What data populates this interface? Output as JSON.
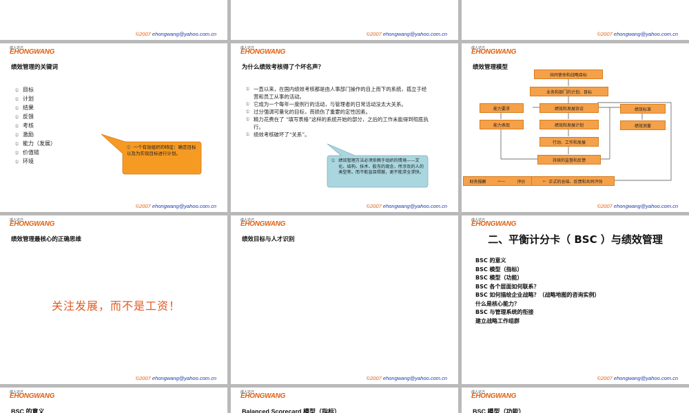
{
  "footer": {
    "year": "©2007",
    "email": "ehongwang@yahoo.com.cn"
  },
  "logo": {
    "caption": "成人达己",
    "brand": "EHONGWANG"
  },
  "slide_kw": {
    "title": "绩效管理的关键词",
    "items": [
      "目标",
      "计划",
      "结果",
      "反馈",
      "考核",
      "激励",
      "能力（发展）",
      "价值链",
      "环境"
    ],
    "callout": "一个有效组织的特征：确定目标以及为实现目标进行计划。"
  },
  "slide_bad": {
    "title": "为什么绩效考核得了个坏名声？",
    "points": [
      "一直以来，在国内绩效考核都是由人事部门操作的自上而下的系统，孤立于经营和员工从事的活动。",
      "它成为一个每年一度例行的活动，与管理者的日常活动没太大关系。",
      "过分强调可量化的目标，而损伤了重要的定性因素。",
      "精力花费在了 “填写表格”这样的系统开始的部分，之后的工作未能得到彻底执行。",
      "绩效考核破坏了“关系”。"
    ],
    "callout": "绩效管理方法必须依赖于组织的情境——文化、结构、技术、股东的观念，所涉及的人的类型等。而不能盲目照搬，更不能求全求快。"
  },
  "slide_model": {
    "title": "绩效管理模型",
    "boxes": {
      "mission": "共同使命和战略目标",
      "dept": "业务和部门的计划、目标",
      "agreement": "绩效和发展协议",
      "plan": "绩效和发展计划",
      "action": "行动、工作和发展",
      "monitor": "持续的监督和反馈",
      "ability_req": "能力要求",
      "ability_show": "能力表现",
      "perf_std": "绩效标准",
      "perf_measure": "绩效测量",
      "review": "正式的总结、反馈和共同评估",
      "eval": "评价",
      "reward": "财务报酬"
    }
  },
  "slide_core": {
    "title": "绩效管理最核心的正确思维",
    "big": "关注发展，而不是工资！"
  },
  "slide_talent": {
    "title": "绩效目标与人才识别"
  },
  "slide_bsc": {
    "title": "二、平衡计分卡（ BSC ）与绩效管理",
    "items": [
      "BSC 的意义",
      "BSC 模型（指标）",
      "BSC 模型（功能）",
      "BSC 各个层面如何联系？",
      "BSC 如何描绘企业战略？（战略地图的咨询实例）",
      "什么是核心能力？",
      "BSC 与管理系统的衔接",
      "建立战略工作组群"
    ]
  },
  "bottom_titles": [
    "BSC 的意义",
    "Balanced Scorecard 模型（指标）",
    "BSC 模型（功能）"
  ]
}
